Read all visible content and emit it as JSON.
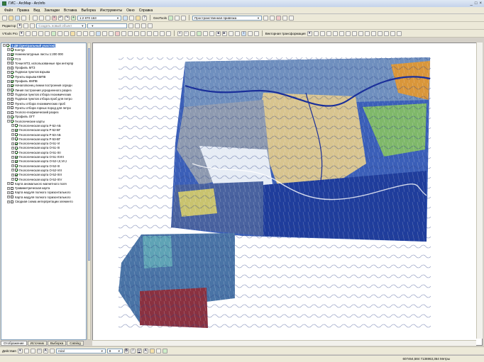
{
  "window": {
    "title": "ГИС - ArcMap - ArcInfo"
  },
  "menu": [
    "Файл",
    "Правка",
    "Вид",
    "Закладки",
    "Вставка",
    "Выборка",
    "Инструменты",
    "Окно",
    "Справка"
  ],
  "toolbar1": {
    "scale": "1:2 870 163",
    "geotools_label": "GeoTools",
    "georef_label": "Пространственная привязка"
  },
  "toolbar2": {
    "editor_label": "Редактор",
    "task_combo": "Создать новый объект"
  },
  "toolbar3": {
    "vtools_label": "VTools Pro",
    "vector_transform_label": "Векторная трансформация"
  },
  "toc": {
    "items": [
      {
        "label": "1-ДВ (Центральный участок)",
        "expander": "−",
        "group": true,
        "checked": true,
        "indent": 0
      },
      {
        "label": "Контур",
        "expander": "+",
        "checked": true,
        "indent": 1
      },
      {
        "label": "Номенклатурные листы 1:200 000",
        "expander": "+",
        "checked": true,
        "indent": 1
      },
      {
        "label": "ГСЭ",
        "expander": "+",
        "checked": true,
        "indent": 1
      },
      {
        "label": "Точки МТЗ, использованные при интерпр",
        "expander": "+",
        "checked": false,
        "indent": 1
      },
      {
        "label": "Профиль МТЗ",
        "expander": "+",
        "checked": false,
        "indent": 1
      },
      {
        "label": "Подписи пунктов взрыва",
        "expander": "+",
        "checked": true,
        "indent": 1
      },
      {
        "label": "Пункты взрыва КМПВ",
        "expander": "+",
        "checked": true,
        "indent": 1
      },
      {
        "label": "Профиль КМПВ",
        "expander": "+",
        "checked": true,
        "indent": 1
      },
      {
        "label": "Начало/конец линии построения осредн",
        "expander": "+",
        "checked": true,
        "indent": 1
      },
      {
        "label": "Линия построения усредненного разрез",
        "expander": "+",
        "checked": true,
        "indent": 1
      },
      {
        "label": "Подписи пунктов отбора геохимических",
        "expander": "+",
        "checked": false,
        "indent": 1
      },
      {
        "label": "Подписи пунктов отбора проб для петро",
        "expander": "+",
        "checked": false,
        "indent": 1
      },
      {
        "label": "Пункты отбора геохимических проб",
        "expander": "+",
        "checked": false,
        "indent": 1
      },
      {
        "label": "Пункты отбора горных пород для петро",
        "expander": "+",
        "checked": false,
        "indent": 1
      },
      {
        "label": "Геолого-геофизический разрез",
        "expander": "+",
        "checked": false,
        "indent": 1
      },
      {
        "label": "Профиль ОГТ",
        "expander": "+",
        "checked": true,
        "indent": 1
      },
      {
        "label": "Геологические карты",
        "expander": "−",
        "checked": true,
        "indent": 1
      },
      {
        "label": "Геологическая карта P-52-АБ",
        "expander": "+",
        "checked": true,
        "indent": 2
      },
      {
        "label": "Геологическая карта P-52-ВГ",
        "expander": "+",
        "checked": true,
        "indent": 2
      },
      {
        "label": "Геологическая карта P-53-АБ",
        "expander": "+",
        "checked": true,
        "indent": 2
      },
      {
        "label": "Геологическая карта P-53-ВГ",
        "expander": "+",
        "checked": true,
        "indent": 2
      },
      {
        "label": "Геологическая карта O-51-VI",
        "expander": "+",
        "checked": true,
        "indent": 2
      },
      {
        "label": "Геологическая карта O-51-XI",
        "expander": "+",
        "checked": true,
        "indent": 2
      },
      {
        "label": "Геологическая карта O-51-XII",
        "expander": "+",
        "checked": true,
        "indent": 2
      },
      {
        "label": "Геологическая карта O-51-XVIII",
        "expander": "+",
        "checked": true,
        "indent": 2
      },
      {
        "label": "Геологическая карта O-52-I,II,VII,I",
        "expander": "+",
        "checked": true,
        "indent": 2
      },
      {
        "label": "Геологическая карта O-52-III",
        "expander": "+",
        "checked": true,
        "indent": 2
      },
      {
        "label": "Геологическая карта O-52-VIII",
        "expander": "+",
        "checked": true,
        "indent": 2
      },
      {
        "label": "Геологическая карта O-52-XIII",
        "expander": "+",
        "checked": true,
        "indent": 2
      },
      {
        "label": "Геологическая карта O-52-XIV",
        "expander": "+",
        "checked": true,
        "indent": 2
      },
      {
        "label": "Карта аномального магнитного поля",
        "expander": "+",
        "checked": false,
        "indent": 1
      },
      {
        "label": "Гравиметрическая карта",
        "expander": "+",
        "checked": false,
        "indent": 1
      },
      {
        "label": "Карта модуля полного горизонтального",
        "expander": "+",
        "checked": false,
        "indent": 1
      },
      {
        "label": "Карта модуля полного горизонтального",
        "expander": "+",
        "checked": false,
        "indent": 1
      },
      {
        "label": "Сводная схема интерпретации элементо",
        "expander": "+",
        "checked": false,
        "indent": 1
      }
    ]
  },
  "tabs": [
    "Отображение",
    "Источник",
    "Выборка",
    "Catalog"
  ],
  "drawing": {
    "actions_label": "Действия",
    "font": "Arial",
    "size": "8"
  },
  "status": {
    "coords": "607464,584  7136963,364 Метры"
  }
}
